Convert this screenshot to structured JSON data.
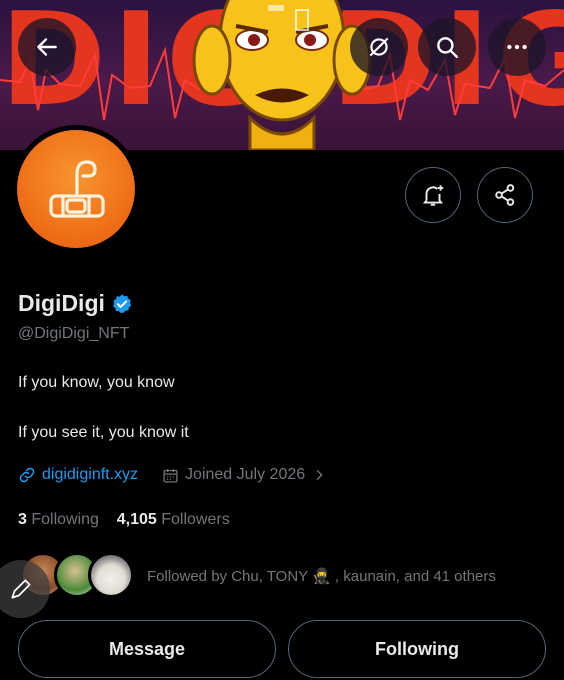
{
  "banner": {
    "title": "DIGIDIGI"
  },
  "profile": {
    "display_name": "DigiDigi",
    "handle": "@DigiDigi_NFT",
    "bio_lines": [
      "If you know, you know",
      "If you see it, you know it"
    ],
    "website": "digidiginft.xyz",
    "joined": "Joined July 2026",
    "following_count": "3",
    "following_label": "Following",
    "followers_count": "4,105",
    "followers_label": "Followers",
    "followed_by": "Followed by Chu, TONY 🥷 , kaunain, and 41 others"
  },
  "actions": {
    "message_label": "Message",
    "following_label": "Following"
  },
  "colors": {
    "accent": "#1d9bf0",
    "verified": "#1d9bf0",
    "avatar_orange": "#ee6b16",
    "banner_red": "#e4351f"
  },
  "icons": [
    "back-arrow-icon",
    "hidden-eye-icon",
    "search-icon",
    "more-icon",
    "bell-plus-icon",
    "share-icon",
    "verified-badge-icon",
    "link-icon",
    "calendar-icon",
    "chevron-right-icon",
    "compose-icon"
  ]
}
